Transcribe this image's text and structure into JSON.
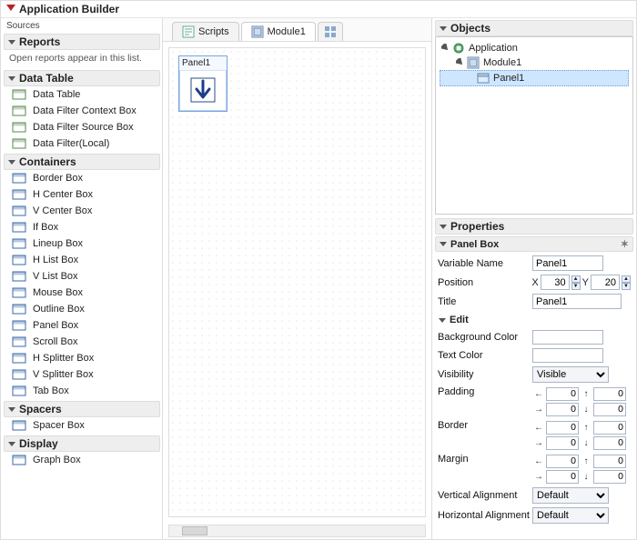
{
  "title": "Application Builder",
  "left": {
    "sourcesLabel": "Sources",
    "sections": {
      "reports": {
        "title": "Reports",
        "note": "Open reports appear in this list."
      },
      "dataTable": {
        "title": "Data Table",
        "items": [
          "Data Table",
          "Data Filter Context Box",
          "Data Filter Source Box",
          "Data Filter(Local)"
        ]
      },
      "containers": {
        "title": "Containers",
        "items": [
          "Border Box",
          "H Center Box",
          "V Center Box",
          "If Box",
          "Lineup Box",
          "H List Box",
          "V List Box",
          "Mouse Box",
          "Outline Box",
          "Panel Box",
          "Scroll Box",
          "H Splitter Box",
          "V Splitter Box",
          "Tab Box"
        ]
      },
      "spacers": {
        "title": "Spacers",
        "items": [
          "Spacer Box"
        ]
      },
      "display": {
        "title": "Display",
        "items": [
          "Graph Box"
        ]
      }
    }
  },
  "tabs": {
    "scripts": "Scripts",
    "module1": "Module1"
  },
  "canvas": {
    "panelLabel": "Panel1"
  },
  "objects": {
    "title": "Objects",
    "tree": {
      "root": "Application",
      "child": "Module1",
      "leaf": "Panel1"
    }
  },
  "properties": {
    "title": "Properties",
    "header": "Panel Box",
    "variableNameLabel": "Variable Name",
    "variableNameValue": "Panel1",
    "positionLabel": "Position",
    "position": {
      "xLabel": "X",
      "x": "30",
      "yLabel": "Y",
      "y": "20"
    },
    "titleLabel": "Title",
    "titleValue": "Panel1",
    "editLabel": "Edit",
    "backgroundColorLabel": "Background Color",
    "textColorLabel": "Text Color",
    "visibilityLabel": "Visibility",
    "visibilityValue": "Visible",
    "paddingLabel": "Padding",
    "borderLabel": "Border",
    "marginLabel": "Margin",
    "padValues": {
      "l": "0",
      "t": "0",
      "r": "0",
      "b": "0"
    },
    "verticalAlignmentLabel": "Vertical Alignment",
    "verticalAlignmentValue": "Default",
    "horizontalAlignmentLabel": "Horizontal Alignment",
    "horizontalAlignmentValue": "Default"
  }
}
